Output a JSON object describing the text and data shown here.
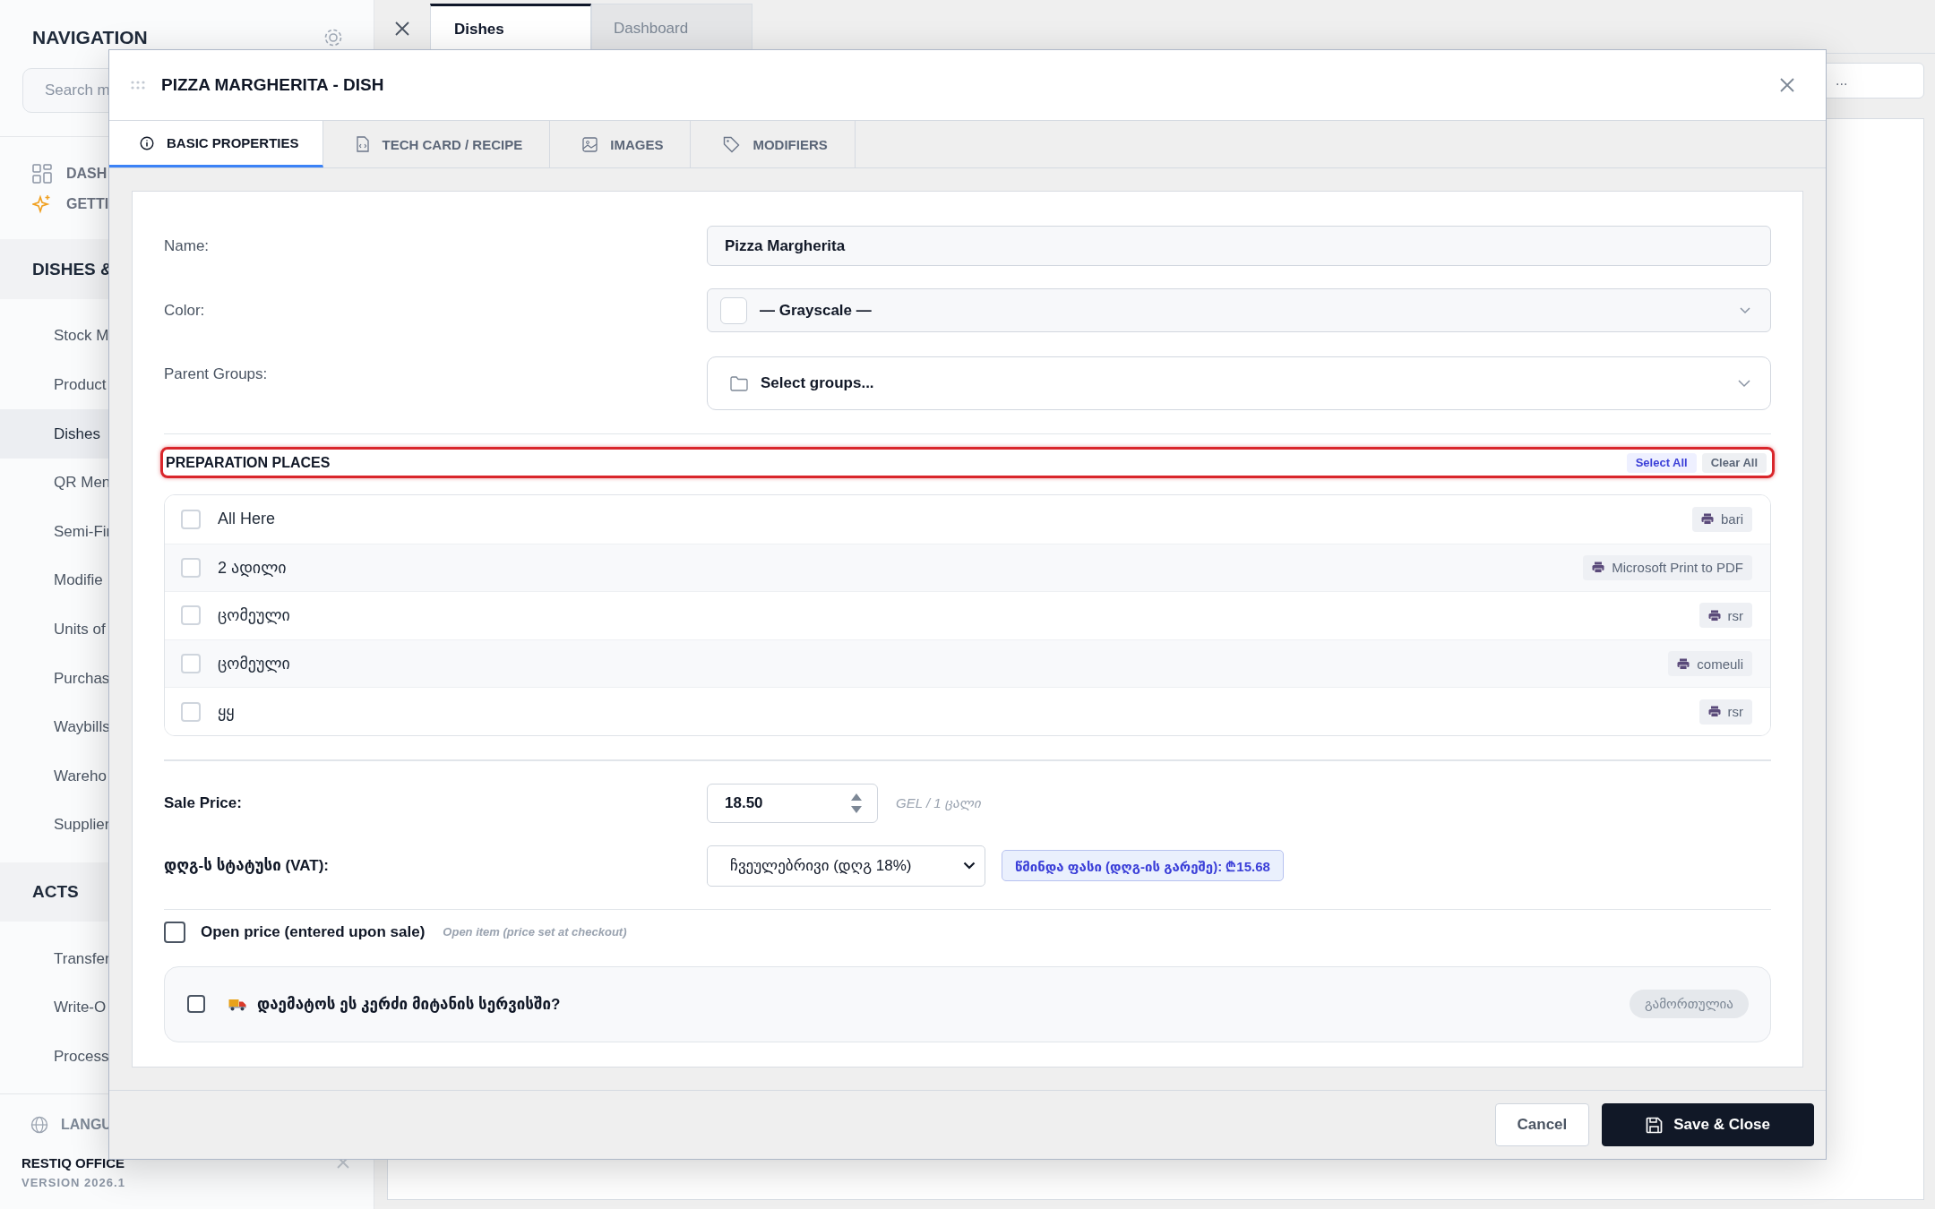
{
  "sidebar": {
    "title": "NAVIGATION",
    "search": {
      "placeholder": "Search m"
    },
    "top_items": [
      {
        "label": "DASH"
      },
      {
        "label": "GETTI"
      }
    ],
    "sections": [
      {
        "title": "DISHES &",
        "items": [
          {
            "label": "Stock M",
            "selected": false
          },
          {
            "label": "Product",
            "selected": false
          },
          {
            "label": "Dishes",
            "selected": true
          },
          {
            "label": "QR Men",
            "selected": false
          },
          {
            "label": "Semi-Fir",
            "selected": false
          },
          {
            "label": "Modifie",
            "selected": false
          },
          {
            "label": "Units of",
            "selected": false
          },
          {
            "label": "Purchas",
            "selected": false
          },
          {
            "label": "Waybills",
            "selected": false
          },
          {
            "label": "Wareho",
            "selected": false
          },
          {
            "label": "Supplier",
            "selected": false
          }
        ]
      },
      {
        "title": "ACTS",
        "items": [
          {
            "label": "Transfer",
            "selected": false
          },
          {
            "label": "Write-O",
            "selected": false
          },
          {
            "label": "Processi",
            "selected": false
          }
        ]
      }
    ],
    "language": "LANGU",
    "product": "RESTIQ OFFICE",
    "version": "VERSION 2026.1"
  },
  "main": {
    "tabs": [
      {
        "label": "Dishes",
        "selected": true
      },
      {
        "label": "Dashboard",
        "selected": false
      }
    ],
    "search": {
      "placeholder": "..."
    }
  },
  "dialog": {
    "title": "PIZZA MARGHERITA - DISH",
    "tabs": [
      {
        "label": "BASIC PROPERTIES",
        "selected": true
      },
      {
        "label": "TECH CARD / RECIPE",
        "selected": false
      },
      {
        "label": "IMAGES",
        "selected": false
      },
      {
        "label": "MODIFIERS",
        "selected": false
      }
    ],
    "name": {
      "label": "Name:",
      "value": "Pizza Margherita"
    },
    "color": {
      "label": "Color:",
      "value": "— Grayscale —"
    },
    "parent_groups": {
      "label": "Parent Groups:",
      "placeholder": "Select groups..."
    },
    "preparation_places": {
      "title": "PREPARATION PLACES",
      "select_all": "Select All",
      "clear_all": "Clear All",
      "items": [
        {
          "name": "All Here",
          "checked": false,
          "printer": "bari"
        },
        {
          "name": "2 ადილი",
          "checked": false,
          "printer": "Microsoft Print to PDF"
        },
        {
          "name": "ცომეული",
          "checked": false,
          "printer": "rsr"
        },
        {
          "name": "ცომეული",
          "checked": false,
          "printer": "comeuli"
        },
        {
          "name": "ყყ",
          "checked": false,
          "printer": "rsr"
        }
      ]
    },
    "sale_price": {
      "label": "Sale Price:",
      "value": "18.50",
      "unit": "GEL / 1 ცალი"
    },
    "vat": {
      "label": "დღგ-ს სტატუსი (VAT):",
      "value": "ჩვეულებრივი (დღგ 18%)",
      "net_price": "წმინდა ფასი (დღგ-ის გარეშე): ₾15.68"
    },
    "open_price": {
      "label": "Open price (entered upon sale)",
      "hint": "Open item (price set at checkout)",
      "checked": false
    },
    "delivery": {
      "label": "დაემატოს ეს კერძი მიტანის სერვისში?",
      "checked": false,
      "status": "გამორთულია"
    },
    "buttons": {
      "cancel": "Cancel",
      "save": "Save & Close"
    }
  }
}
